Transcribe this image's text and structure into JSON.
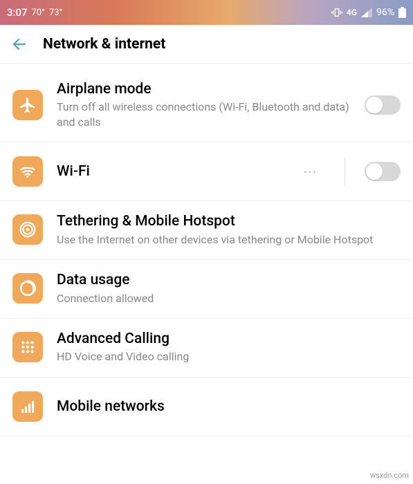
{
  "statusbar": {
    "time": "3:07",
    "temp1": "70°",
    "temp2": "73°",
    "network_label": "4G",
    "battery_pct": "96%"
  },
  "header": {
    "title": "Network & internet"
  },
  "items": {
    "airplane": {
      "title": "Airplane mode",
      "sub": "Turn off all wireless connections (Wi-Fi, Bluetooth and data) and calls"
    },
    "wifi": {
      "title": "Wi-Fi"
    },
    "tethering": {
      "title": "Tethering & Mobile Hotspot",
      "sub": "Use the Internet on other devices via tethering or Mobile Hotspot"
    },
    "datausage": {
      "title": "Data usage",
      "sub": "Connection allowed"
    },
    "advcalling": {
      "title": "Advanced Calling",
      "sub": "HD Voice and Video calling"
    },
    "mobilenet": {
      "title": "Mobile networks"
    }
  },
  "watermark": "wsxdn.com",
  "colors": {
    "icon_bg": "#f0a85a",
    "back_arrow": "#5aa0a8"
  }
}
